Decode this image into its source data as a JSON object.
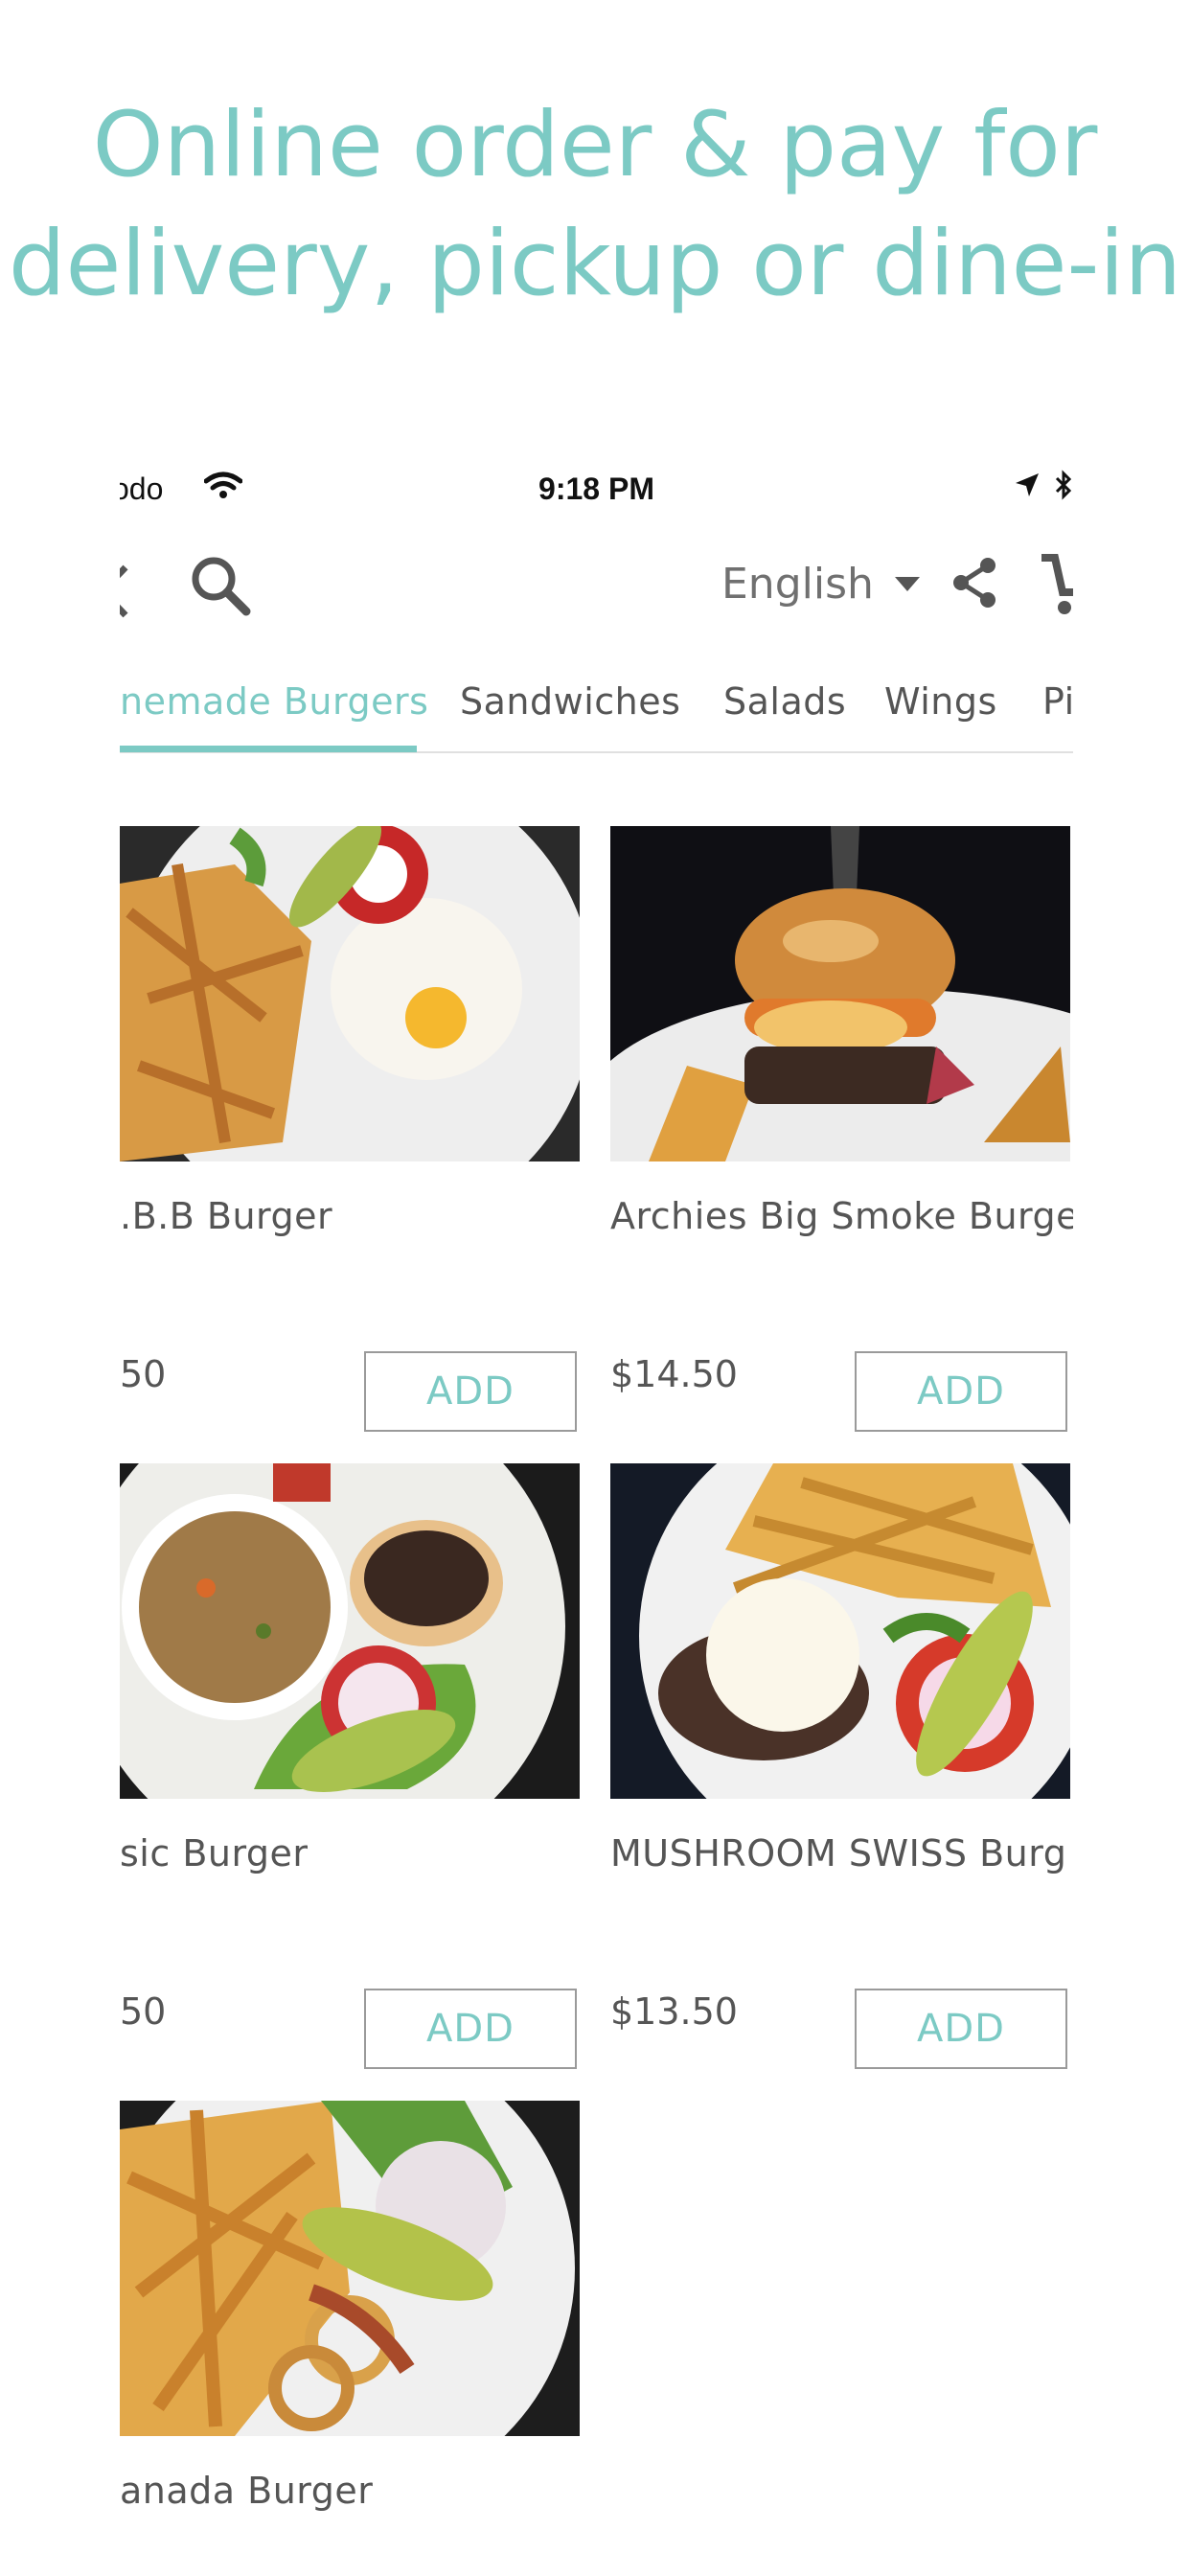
{
  "headline": {
    "line1": "Online order & pay for",
    "line2": "delivery, pickup or dine-in"
  },
  "status_bar": {
    "carrier": "odo",
    "time": "9:18 PM"
  },
  "toolbar": {
    "language": "English"
  },
  "tabs": [
    {
      "label": "nemade Burgers",
      "active": true
    },
    {
      "label": "Sandwiches"
    },
    {
      "label": "Salads"
    },
    {
      "label": "Wings"
    },
    {
      "label": "Pi"
    }
  ],
  "products": [
    {
      "name": ".B.B Burger",
      "price": "50",
      "add_label": "ADD"
    },
    {
      "name": "Archies Big Smoke Burge",
      "price": "$14.50",
      "add_label": "ADD"
    },
    {
      "name": "sic Burger",
      "price": "50",
      "add_label": "ADD"
    },
    {
      "name": "MUSHROOM SWISS Burg",
      "price": "$13.50",
      "add_label": "ADD"
    },
    {
      "name": "anada Burger"
    }
  ],
  "colors": {
    "accent": "#7ccac4",
    "text": "#555555"
  }
}
